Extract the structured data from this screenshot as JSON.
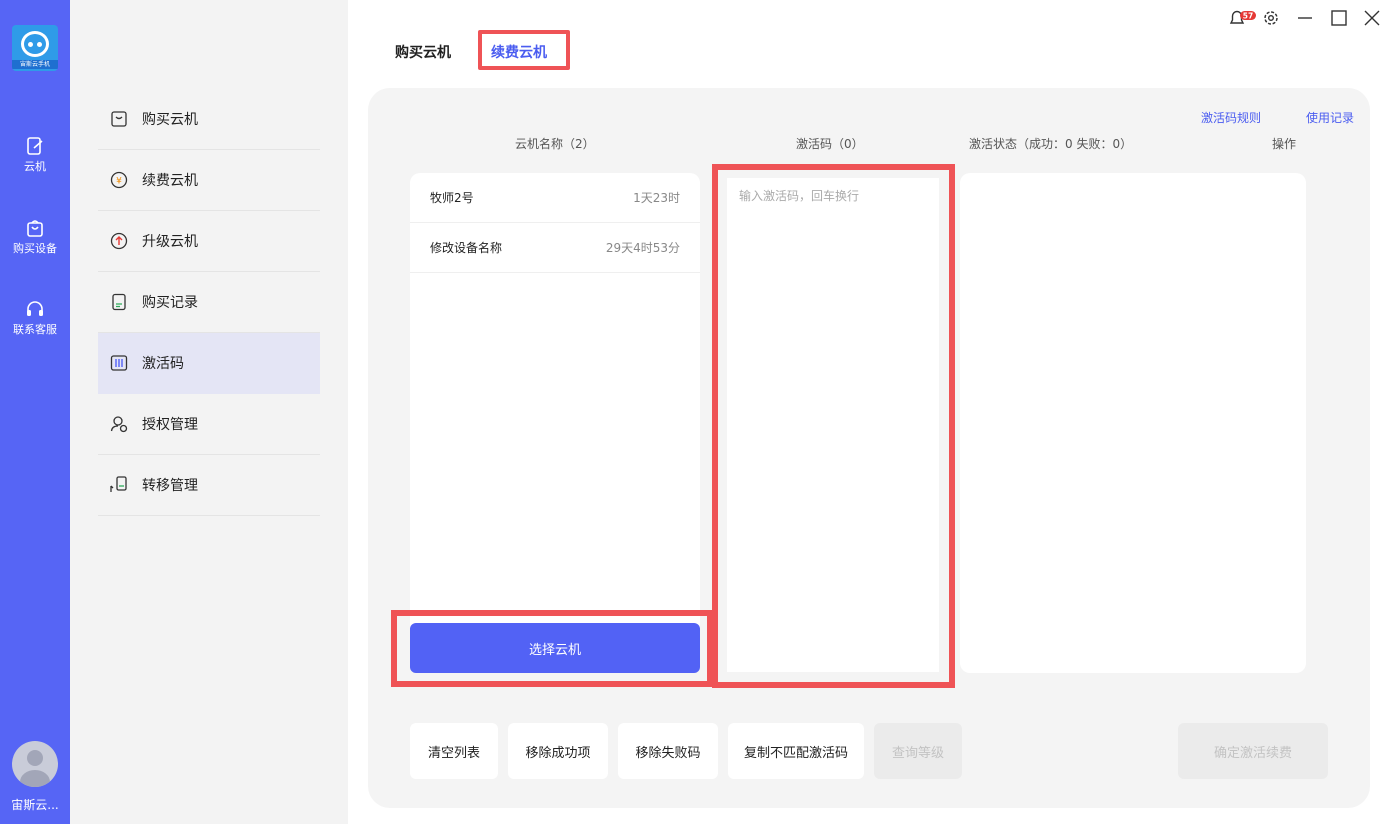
{
  "rail": {
    "logo_text": "宙斯云手机",
    "items": [
      {
        "label": "云机"
      },
      {
        "label": "购买设备"
      },
      {
        "label": "联系客服"
      }
    ],
    "user_name": "宙斯云..."
  },
  "sidemenu": {
    "items": [
      {
        "label": "购买云机"
      },
      {
        "label": "续费云机"
      },
      {
        "label": "升级云机"
      },
      {
        "label": "购买记录"
      },
      {
        "label": "激活码"
      },
      {
        "label": "授权管理"
      },
      {
        "label": "转移管理"
      }
    ],
    "active_index": 4
  },
  "tabs": [
    {
      "label": "购买云机"
    },
    {
      "label": "续费云机",
      "active": true
    }
  ],
  "topbar": {
    "notification_count": "57"
  },
  "links": {
    "code_rules": "激活码规则",
    "usage_log": "使用记录"
  },
  "columns": {
    "vm_name": "云机名称（2）",
    "code": "激活码（0）",
    "status": "激活状态（成功：0 失败：0）",
    "action": "操作"
  },
  "vms": [
    {
      "name": "牧师2号",
      "remaining": "1天23时"
    },
    {
      "name": "修改设备名称",
      "remaining": "29天4时53分"
    }
  ],
  "code_input": {
    "placeholder": "输入激活码，回车换行",
    "value": ""
  },
  "buttons": {
    "select_vm": "选择云机",
    "clear": "清空列表",
    "remove_success": "移除成功项",
    "remove_failed": "移除失败码",
    "copy_unmatched": "复制不匹配激活码",
    "query_level": "查询等级",
    "confirm": "确定激活续费"
  },
  "colors": {
    "accent": "#5262f5",
    "rail": "#5665f5",
    "highlight": "#ef5356"
  }
}
